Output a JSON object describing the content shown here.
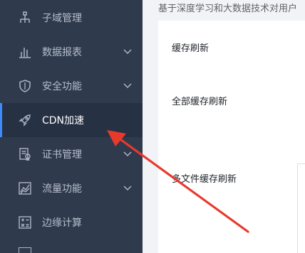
{
  "sidebar": {
    "items": [
      {
        "label": "子域管理",
        "icon": "sitemap-icon",
        "has_chevron": false
      },
      {
        "label": "数据报表",
        "icon": "bar-chart-icon",
        "has_chevron": true
      },
      {
        "label": "安全功能",
        "icon": "shield-icon",
        "has_chevron": true
      },
      {
        "label": "CDN加速",
        "icon": "rocket-icon",
        "has_chevron": false,
        "active": true
      },
      {
        "label": "证书管理",
        "icon": "certificate-icon",
        "has_chevron": true
      },
      {
        "label": "流量功能",
        "icon": "line-chart-icon",
        "has_chevron": true
      },
      {
        "label": "边缘计算",
        "icon": "calculator-icon",
        "has_chevron": false
      }
    ]
  },
  "content": {
    "subtitle": "基于深度学习和大数据技术对用户",
    "cache_refresh_label": "缓存刷新",
    "full_refresh_label": "全部缓存刷新",
    "multi_file_refresh_label": "多文件缓存刷新"
  },
  "colors": {
    "sidebar_bg": "#2f3a4d",
    "active_accent": "#3d8bfd",
    "annotation_arrow": "#e8392d"
  }
}
